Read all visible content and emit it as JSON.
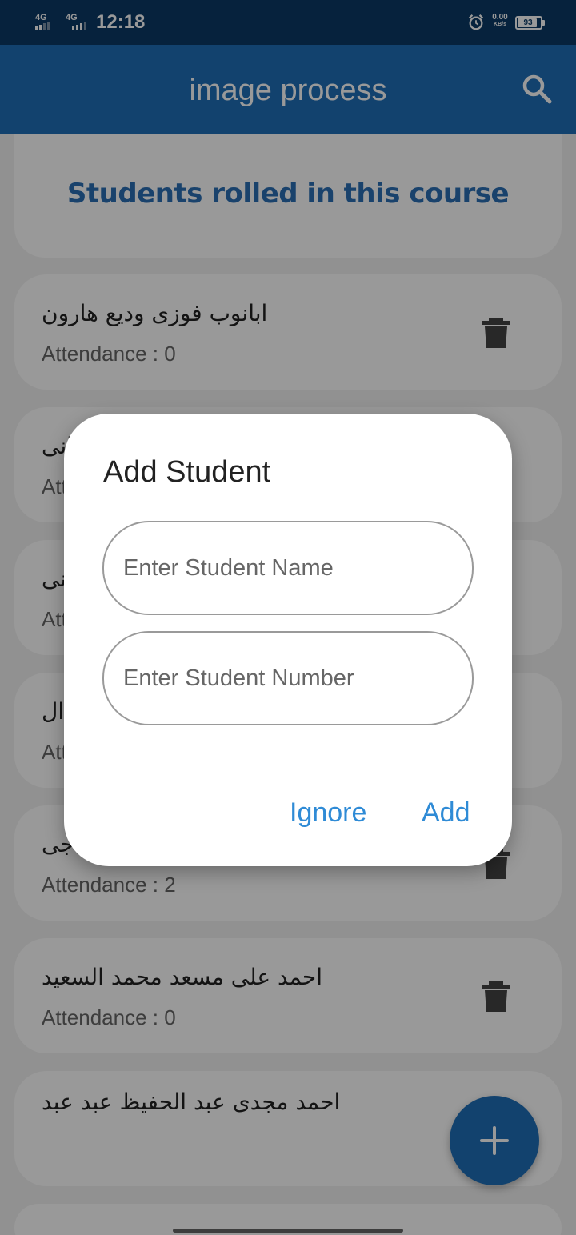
{
  "status_bar": {
    "network_1": "4G",
    "network_2": "4G",
    "time": "12:18",
    "speed_value": "0.00",
    "speed_unit": "KB/s",
    "battery": "93",
    "icons": [
      "signal-icon",
      "alarm-icon",
      "battery-icon"
    ]
  },
  "app_bar": {
    "title": "image process",
    "search_icon": "search-icon"
  },
  "banner": {
    "text": "Students rolled in this course"
  },
  "students": [
    {
      "name": "ابانوب فوزى وديع هارون",
      "attendance": "Attendance : 0"
    },
    {
      "name": "انى",
      "attendance": "Att"
    },
    {
      "name": "انى",
      "attendance": "Att"
    },
    {
      "name": "ال",
      "attendance": "Att"
    },
    {
      "name": "جى",
      "attendance": "Attendance : 2"
    },
    {
      "name": "احمد على مسعد محمد السعيد",
      "attendance": "Attendance : 0"
    },
    {
      "name": "احمد مجدى عبد الحفيظ عبد عبد",
      "attendance": ""
    }
  ],
  "dialog": {
    "title": "Add Student",
    "name_placeholder": "Enter Student Name",
    "number_placeholder": "Enter Student Number",
    "ignore_label": "Ignore",
    "add_label": "Add"
  },
  "fab": {
    "icon": "plus-icon"
  },
  "colors": {
    "primary": "#1f6fb8",
    "status_bar": "#0b3a66",
    "accent_text": "#2f8bd6",
    "banner_text": "#2b6fb5"
  }
}
